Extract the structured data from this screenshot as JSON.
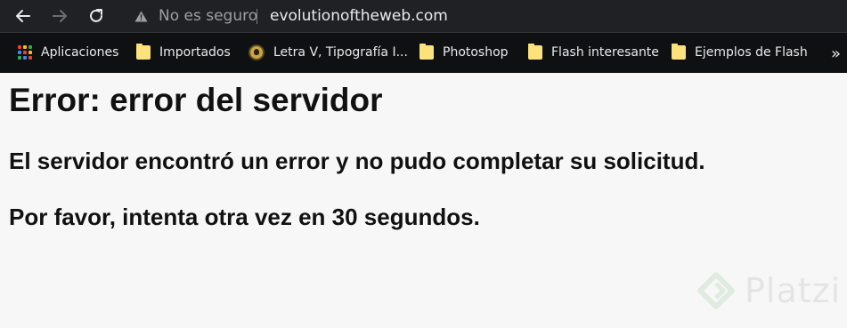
{
  "toolbar": {
    "security_label": "No es seguro",
    "url": "evolutionoftheweb.com"
  },
  "bookmarks": [
    {
      "label": "Aplicaciones",
      "icon": "apps-grid-icon"
    },
    {
      "label": "Importados",
      "icon": "folder-icon"
    },
    {
      "label": "Letra V, Tipografía I...",
      "icon": "site-favicon"
    },
    {
      "label": "Photoshop",
      "icon": "folder-icon"
    },
    {
      "label": "Flash interesante",
      "icon": "folder-icon"
    },
    {
      "label": "Ejemplos de Flash",
      "icon": "folder-icon"
    }
  ],
  "overflow_label": "»",
  "page": {
    "heading": "Error: error del servidor",
    "message1": "El servidor encontró un error y no pudo completar su solicitud.",
    "message2": "Por favor, intenta otra vez en 30 segundos."
  },
  "watermark": {
    "text": "Platzi"
  },
  "colors": {
    "toolbar_bg": "#202124",
    "bookmarks_bg": "#0f1012",
    "page_bg": "#f7f7f7",
    "folder": "#fce27a"
  }
}
